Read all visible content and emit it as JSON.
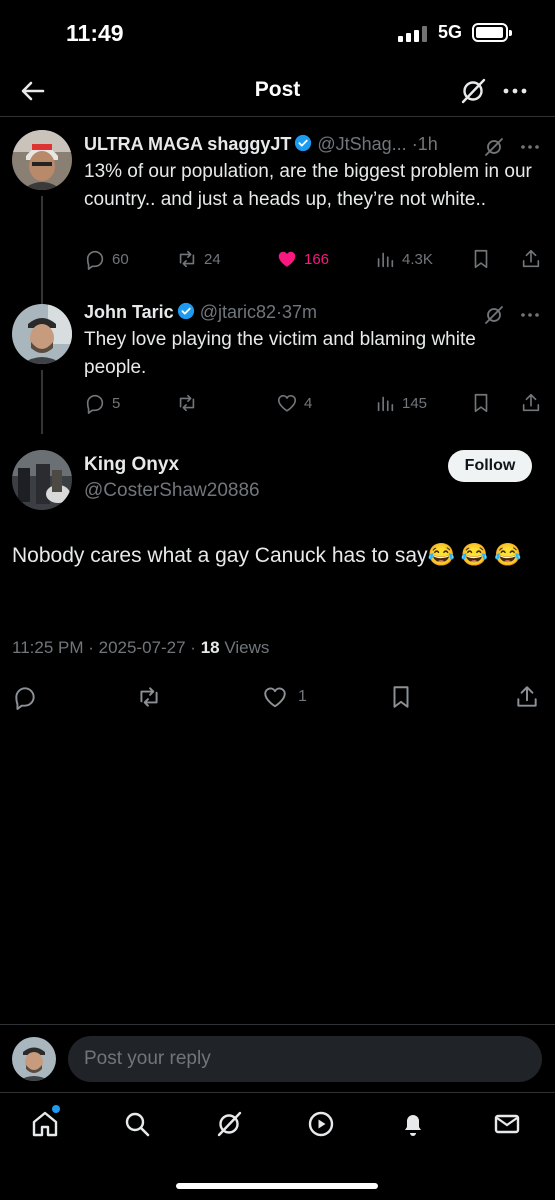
{
  "status_bar": {
    "time": "11:49",
    "network": "5G"
  },
  "header": {
    "title": "Post",
    "icons": {
      "back": "back-arrow-icon",
      "grok": "grok-icon",
      "more": "more-icon"
    }
  },
  "thread": [
    {
      "name": "ULTRA MAGA shaggyJT",
      "verified": true,
      "handle": "@JtShag...",
      "dot": "·",
      "time": "1h",
      "text": "13% of our population, are the biggest problem in our country..  and just a heads up, they’re not white..",
      "replies": "60",
      "reposts": "24",
      "likes": "166",
      "liked": true,
      "views": "4.3K"
    },
    {
      "name": "John Taric",
      "verified": true,
      "handle": "@jtaric82",
      "dot": "·",
      "time": "37m",
      "text": "They love playing the victim and blaming white people.",
      "replies": "5",
      "reposts": "",
      "likes": "4",
      "liked": false,
      "views": "145"
    }
  ],
  "main_post": {
    "name": "King Onyx",
    "handle": "@CosterShaw20886",
    "follow_label": "Follow",
    "text": "Nobody cares what a gay Canuck has to say",
    "emoji": "😂",
    "timestamp": "11:25 PM · 2025-07-27 · ",
    "views_count": "18",
    "views_label": " Views",
    "likes": "1"
  },
  "reply": {
    "placeholder": "Post your reply"
  },
  "colors": {
    "like": "#f91880",
    "verified": "#1d9bf0",
    "muted": "#71767b",
    "divider": "#2f3336"
  }
}
